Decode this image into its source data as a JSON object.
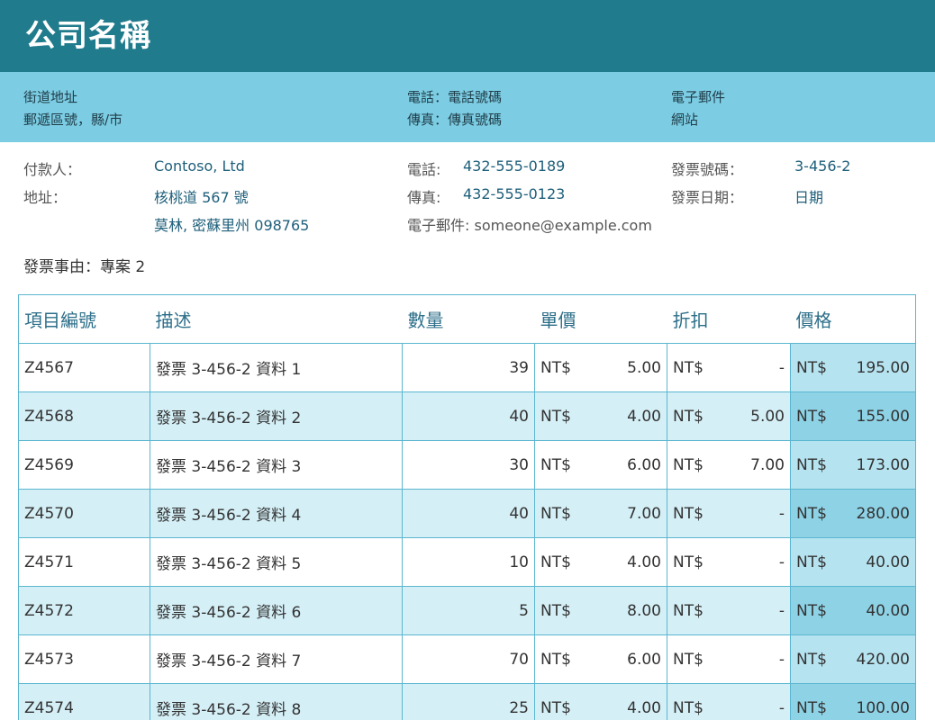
{
  "company": {
    "name": "公司名稱",
    "address_line1": "街道地址",
    "address_line2": "郵遞區號，縣/市",
    "phone": "電話：電話號碼",
    "fax": "傳真：傳真號碼",
    "email": "電子郵件",
    "website": "網站"
  },
  "bill_to": {
    "payer_label": "付款人：",
    "payer": "Contoso, Ltd",
    "address_label": "地址：",
    "address_line1": "核桃道 567 號",
    "address_line2": "莫林, 密蘇里州 098765",
    "phone_label": "電話:",
    "phone": "432-555-0189",
    "fax_label": "傳真:",
    "fax": "432-555-0123",
    "email_line": "電子郵件: someone@example.com",
    "invoice_no_label": "發票號碼：",
    "invoice_no": "3-456-2",
    "invoice_date_label": "發票日期：",
    "invoice_date": "日期"
  },
  "reason": "發票事由：專案 2",
  "table": {
    "headers": {
      "item_no": "項目編號",
      "description": "描述",
      "quantity": "數量",
      "unit_price": "單價",
      "discount": "折扣",
      "price": "價格"
    },
    "currency": "NT$",
    "rows": [
      {
        "item": "Z4567",
        "desc": "發票 3-456-2 資料 1",
        "qty": "39",
        "unit": "5.00",
        "disc": "-",
        "price": "195.00"
      },
      {
        "item": "Z4568",
        "desc": "發票 3-456-2 資料 2",
        "qty": "40",
        "unit": "4.00",
        "disc": "5.00",
        "price": "155.00"
      },
      {
        "item": "Z4569",
        "desc": "發票 3-456-2 資料 3",
        "qty": "30",
        "unit": "6.00",
        "disc": "7.00",
        "price": "173.00"
      },
      {
        "item": "Z4570",
        "desc": "發票 3-456-2 資料 4",
        "qty": "40",
        "unit": "7.00",
        "disc": "-",
        "price": "280.00"
      },
      {
        "item": "Z4571",
        "desc": "發票 3-456-2 資料 5",
        "qty": "10",
        "unit": "4.00",
        "disc": "-",
        "price": "40.00"
      },
      {
        "item": "Z4572",
        "desc": "發票 3-456-2 資料 6",
        "qty": "5",
        "unit": "8.00",
        "disc": "-",
        "price": "40.00"
      },
      {
        "item": "Z4573",
        "desc": "發票 3-456-2 資料 7",
        "qty": "70",
        "unit": "6.00",
        "disc": "-",
        "price": "420.00"
      },
      {
        "item": "Z4574",
        "desc": "發票 3-456-2 資料 8",
        "qty": "25",
        "unit": "4.00",
        "disc": "-",
        "price": "100.00"
      }
    ]
  },
  "colors": {
    "header_bg": "#207b8c",
    "info_bg": "#7ccde3",
    "row_alt": "#d4eff6",
    "price_col": "#b6e3f0",
    "price_col_alt": "#8ed2e6",
    "border": "#5bb6cf"
  }
}
